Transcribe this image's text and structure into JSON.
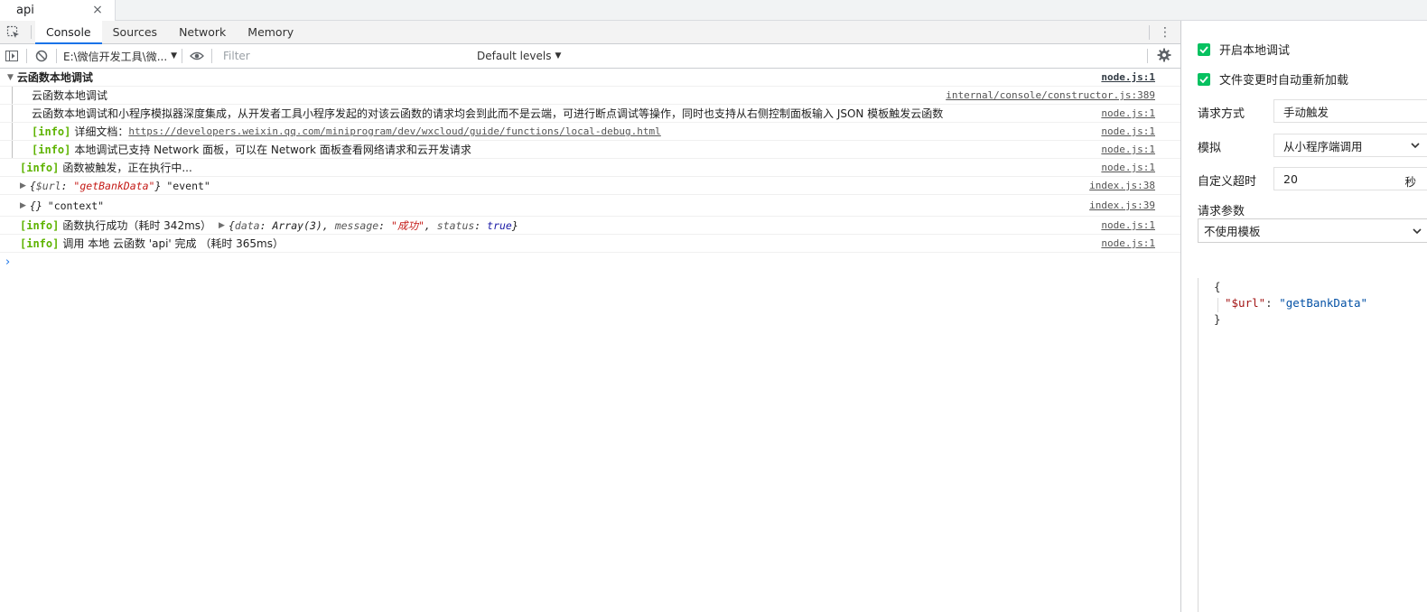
{
  "window": {
    "tab_title": "api",
    "close_glyph": "×"
  },
  "devtools": {
    "tabs": [
      {
        "label": "Console",
        "active": true
      },
      {
        "label": "Sources"
      },
      {
        "label": "Network"
      },
      {
        "label": "Memory"
      }
    ],
    "toolbar": {
      "context": "E:\\微信开发工具\\微...",
      "filter_placeholder": "Filter",
      "levels": "Default levels"
    }
  },
  "console": {
    "group": {
      "title": "云函数本地调试",
      "title_src": "node.js:1",
      "rows": [
        {
          "text": "云函数本地调试",
          "src": "internal/console/constructor.js:389"
        },
        {
          "text": "云函数本地调试和小程序模拟器深度集成，从开发者工具小程序发起的对该云函数的请求均会到此而不是云端，可进行断点调试等操作，同时也支持从右侧控制面板输入 JSON 模板触发云函数",
          "src": "node.js:1"
        },
        {
          "tag": "[info]",
          "text": "详细文档：",
          "link": "https://developers.weixin.qq.com/miniprogram/dev/wxcloud/guide/functions/local-debug.html",
          "src": "node.js:1"
        },
        {
          "tag": "[info]",
          "text": "本地调试已支持 Network 面板，可以在 Network 面板查看网络请求和云开发请求",
          "src": "node.js:1"
        }
      ]
    },
    "row_trigger": {
      "tag": "[info]",
      "text": "函数被触发，正在执行中...",
      "src": "node.js:1"
    },
    "row_event": {
      "obj_open": "{",
      "key": "$url",
      "sep": ": ",
      "value": "\"getBankData\"",
      "obj_close": "}",
      "label": "\"event\"",
      "src": "index.js:38"
    },
    "row_context": {
      "obj": "{}",
      "label": "\"context\"",
      "src": "index.js:39"
    },
    "row_success": {
      "tag": "[info]",
      "text": "函数执行成功（耗时 342ms）",
      "obj_open": "{",
      "k1": "data",
      "v1": "Array(3)",
      "k2": "message",
      "v2": "\"成功\"",
      "k3": "status",
      "v3": "true",
      "obj_close": "}",
      "src": "node.js:1"
    },
    "row_done": {
      "tag": "[info]",
      "text": "调用 本地 云函数 'api' 完成  （耗时 365ms）",
      "src": "node.js:1"
    },
    "prompt": "›"
  },
  "panel": {
    "enable_local_debug": "开启本地调试",
    "auto_reload": "文件变更时自动重新加载",
    "request_method_label": "请求方式",
    "request_method_value": "手动触发",
    "simulate_label": "模拟",
    "simulate_value": "从小程序端调用",
    "timeout_label": "自定义超时",
    "timeout_value": "20",
    "timeout_unit": "秒",
    "params_label": "请求参数",
    "template_value": "不使用模板",
    "json": {
      "open": "{",
      "key": "\"$url\"",
      "colon": ": ",
      "value": "\"getBankData\"",
      "close": "}"
    }
  },
  "colors": {
    "accent": "#1a73e8",
    "info_green": "#5db300",
    "check_green": "#07c160",
    "string_red": "#c41a16"
  }
}
